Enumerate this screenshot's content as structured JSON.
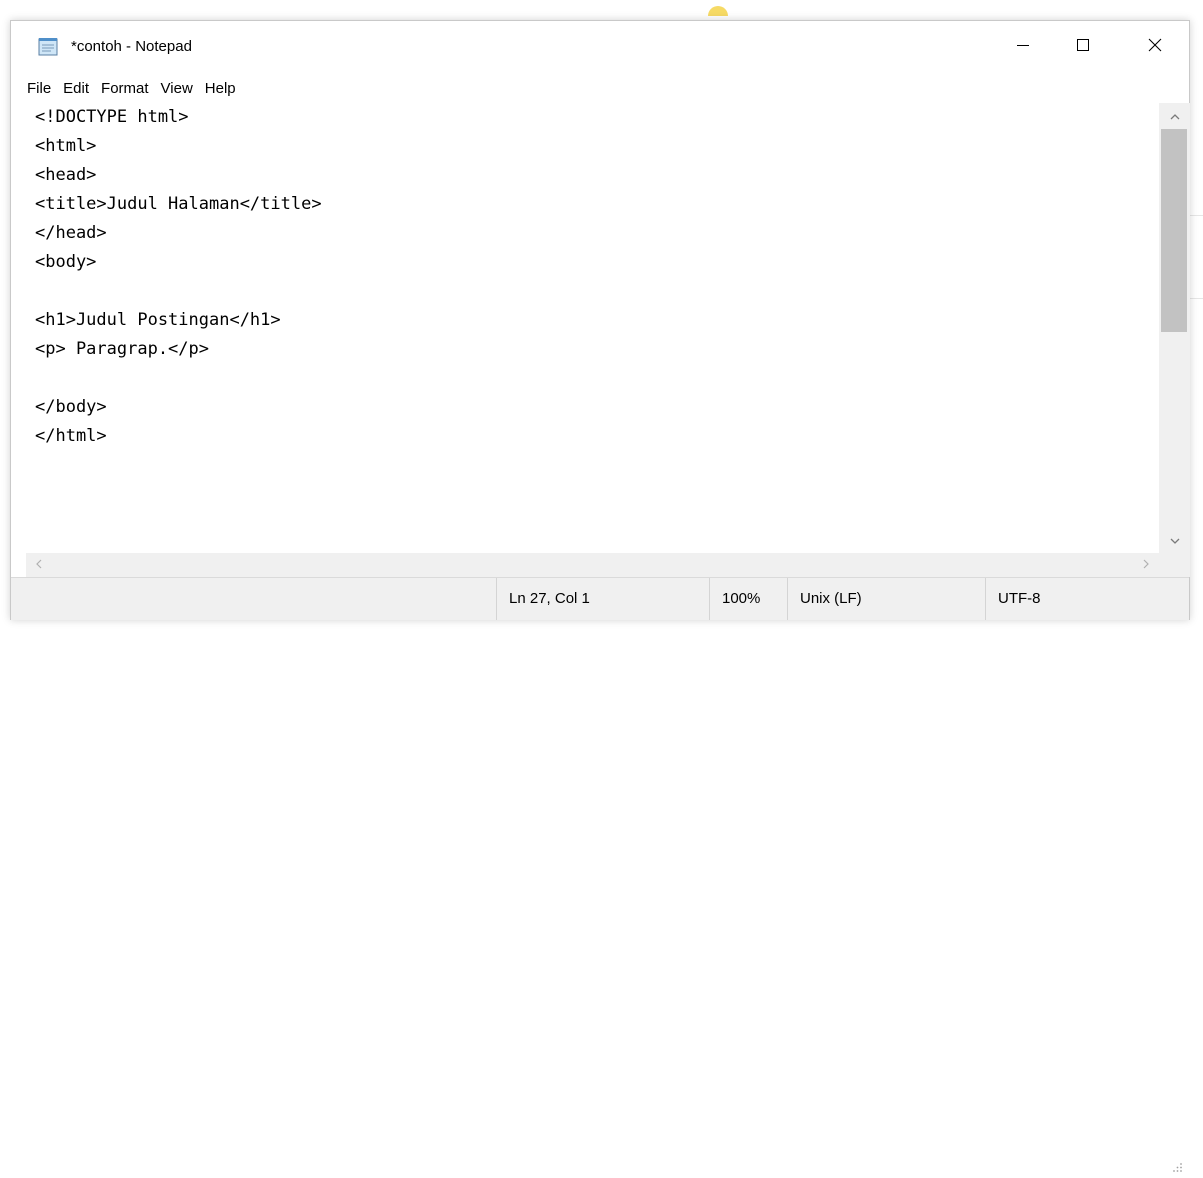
{
  "window": {
    "title": "*contoh - Notepad"
  },
  "menu": {
    "items": [
      "File",
      "Edit",
      "Format",
      "View",
      "Help"
    ]
  },
  "editor": {
    "lines": [
      "<!DOCTYPE html>",
      "<html>",
      "<head>",
      "<title>Judul Halaman</title>",
      "</head>",
      "<body>",
      "",
      "<h1>Judul Postingan</h1>",
      "<p> Paragrap.</p>",
      "",
      "</body>",
      "</html>"
    ]
  },
  "status": {
    "position": "Ln 27, Col 1",
    "zoom": "100%",
    "line_ending": "Unix (LF)",
    "encoding": "UTF-8"
  },
  "icons": {
    "app": "notepad-icon",
    "minimize": "minimize-icon",
    "maximize": "maximize-icon",
    "close": "close-icon",
    "scroll_up": "chevron-up-icon",
    "scroll_down": "chevron-down-icon",
    "scroll_left": "chevron-left-icon",
    "scroll_right": "chevron-right-icon",
    "grip": "resize-grip-icon"
  },
  "colors": {
    "window_bg": "#ffffff",
    "statusbar_bg": "#f0f0f0",
    "scroll_thumb": "#c2c2c2"
  }
}
